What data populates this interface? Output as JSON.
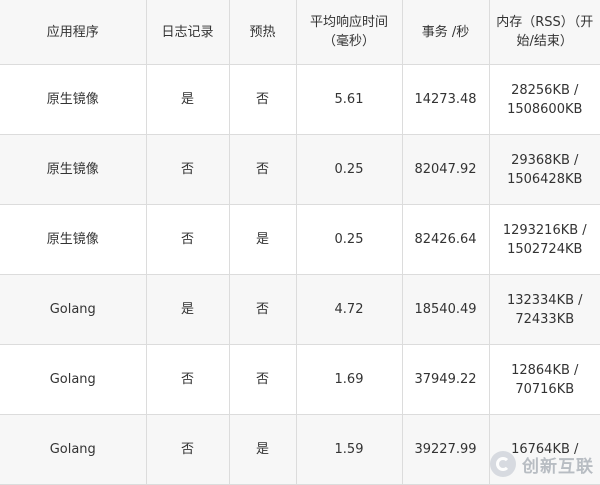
{
  "table": {
    "headers": [
      "应用程序",
      "日志记录",
      "预热",
      "平均响应时间（毫秒）",
      "事务 /秒",
      "内存（RSS）（开始/结束）"
    ],
    "rows": [
      {
        "app": "原生镜像",
        "logging": "是",
        "warmup": "否",
        "avg_response": "5.61",
        "tps": "14273.48",
        "mem_start": "28256KB /",
        "mem_end": "1508600KB"
      },
      {
        "app": "原生镜像",
        "logging": "否",
        "warmup": "否",
        "avg_response": "0.25",
        "tps": "82047.92",
        "mem_start": "29368KB /",
        "mem_end": "1506428KB"
      },
      {
        "app": "原生镜像",
        "logging": "否",
        "warmup": "是",
        "avg_response": "0.25",
        "tps": "82426.64",
        "mem_start": "1293216KB /",
        "mem_end": "1502724KB"
      },
      {
        "app": "Golang",
        "logging": "是",
        "warmup": "否",
        "avg_response": "4.72",
        "tps": "18540.49",
        "mem_start": "132334KB /",
        "mem_end": "72433KB"
      },
      {
        "app": "Golang",
        "logging": "否",
        "warmup": "否",
        "avg_response": "1.69",
        "tps": "37949.22",
        "mem_start": "12864KB /",
        "mem_end": "70716KB"
      },
      {
        "app": "Golang",
        "logging": "否",
        "warmup": "是",
        "avg_response": "1.59",
        "tps": "39227.99",
        "mem_start": "16764KB /",
        "mem_end": ""
      }
    ]
  },
  "watermark": {
    "text": "创新互联",
    "logo_icon": "swirl-logo-icon"
  }
}
